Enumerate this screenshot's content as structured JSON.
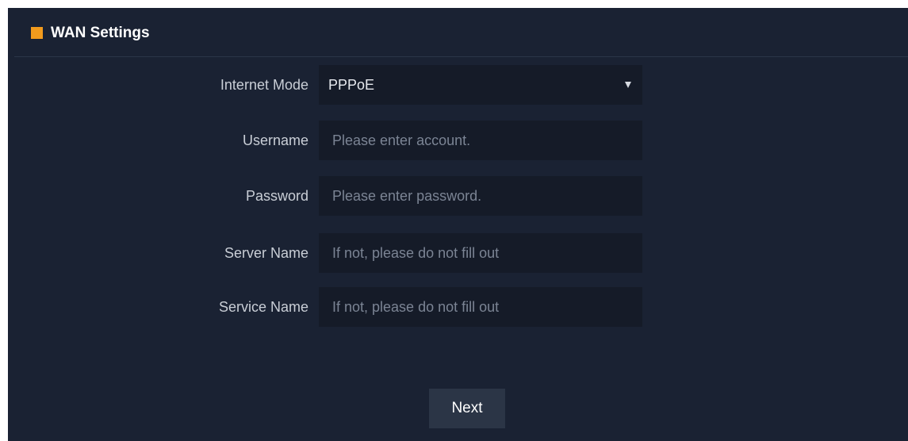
{
  "colors": {
    "panel_background": "#1a2233",
    "field_background": "#151b28",
    "accent": "#f29b1d",
    "button_background": "#2b3546",
    "label_text": "#c9ced6",
    "placeholder_text": "#7b8494"
  },
  "header": {
    "icon": "square-icon",
    "title": "WAN Settings"
  },
  "form": {
    "internet_mode": {
      "label": "Internet Mode",
      "value": "PPPoE",
      "icon": "dropdown-arrow-icon"
    },
    "username": {
      "label": "Username",
      "placeholder": "Please enter account.",
      "value": ""
    },
    "password": {
      "label": "Password",
      "placeholder": "Please enter password.",
      "value": ""
    },
    "server_name": {
      "label": "Server Name",
      "placeholder": "If not, please do not fill out",
      "value": ""
    },
    "service_name": {
      "label": "Service Name",
      "placeholder": "If not, please do not fill out",
      "value": ""
    }
  },
  "actions": {
    "next_label": "Next"
  }
}
